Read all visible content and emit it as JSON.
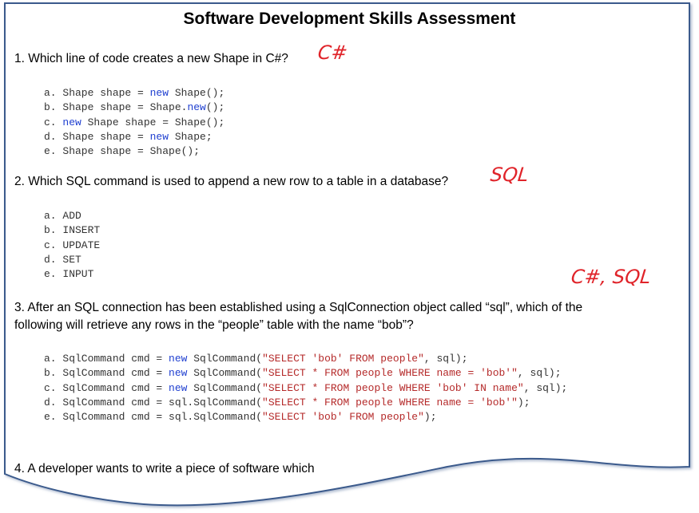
{
  "title": "Software Development Skills Assessment",
  "q1": {
    "text": "1. Which line of code creates a new Shape in C#?",
    "note": "C#",
    "options": [
      [
        {
          "t": "a. Shape shape = ",
          "c": ""
        },
        {
          "t": "new",
          "c": "kw"
        },
        {
          "t": " Shape();",
          "c": ""
        }
      ],
      [
        {
          "t": "b. Shape shape = Shape.",
          "c": ""
        },
        {
          "t": "new",
          "c": "kw"
        },
        {
          "t": "();",
          "c": ""
        }
      ],
      [
        {
          "t": "c. ",
          "c": ""
        },
        {
          "t": "new",
          "c": "kw"
        },
        {
          "t": " Shape shape = Shape();",
          "c": ""
        }
      ],
      [
        {
          "t": "d. Shape shape = ",
          "c": ""
        },
        {
          "t": "new",
          "c": "kw"
        },
        {
          "t": " Shape;",
          "c": ""
        }
      ],
      [
        {
          "t": "e. Shape shape = Shape();",
          "c": ""
        }
      ]
    ]
  },
  "q2": {
    "text": "2. Which SQL command is used to append a new row to a table in a database?",
    "note": "SQL",
    "options": [
      [
        {
          "t": "a. ADD",
          "c": ""
        }
      ],
      [
        {
          "t": "b. INSERT",
          "c": ""
        }
      ],
      [
        {
          "t": "c. UPDATE",
          "c": ""
        }
      ],
      [
        {
          "t": "d. SET",
          "c": ""
        }
      ],
      [
        {
          "t": "e. INPUT",
          "c": ""
        }
      ]
    ]
  },
  "q3": {
    "text_line1": "3. After an SQL connection has been established using a SqlConnection object called “sql”, which of the",
    "text_line2": "following will retrieve any rows in the “people” table with the name “bob”?",
    "note": "C#, SQL",
    "options": [
      [
        {
          "t": "a. SqlCommand cmd = ",
          "c": ""
        },
        {
          "t": "new",
          "c": "kw"
        },
        {
          "t": " SqlCommand(",
          "c": ""
        },
        {
          "t": "\"SELECT 'bob' FROM people\"",
          "c": "str"
        },
        {
          "t": ", sql);",
          "c": ""
        }
      ],
      [
        {
          "t": "b. SqlCommand cmd = ",
          "c": ""
        },
        {
          "t": "new",
          "c": "kw"
        },
        {
          "t": " SqlCommand(",
          "c": ""
        },
        {
          "t": "\"SELECT * FROM people WHERE name = 'bob'\"",
          "c": "str"
        },
        {
          "t": ", sql);",
          "c": ""
        }
      ],
      [
        {
          "t": "c. SqlCommand cmd = ",
          "c": ""
        },
        {
          "t": "new",
          "c": "kw"
        },
        {
          "t": " SqlCommand(",
          "c": ""
        },
        {
          "t": "\"SELECT * FROM people WHERE 'bob' IN name\"",
          "c": "str"
        },
        {
          "t": ", sql);",
          "c": ""
        }
      ],
      [
        {
          "t": "d. SqlCommand cmd = sql.SqlCommand(",
          "c": ""
        },
        {
          "t": "\"SELECT * FROM people WHERE name = 'bob'\"",
          "c": "str"
        },
        {
          "t": ");",
          "c": ""
        }
      ],
      [
        {
          "t": "e. SqlCommand cmd = sql.SqlCommand(",
          "c": ""
        },
        {
          "t": "\"SELECT 'bob' FROM people\"",
          "c": "str"
        },
        {
          "t": ");",
          "c": ""
        }
      ]
    ]
  },
  "q4": {
    "text": "4. A developer wants to write a piece of software which"
  },
  "colors": {
    "border": "#3a5a8c",
    "annotation": "#e0242a",
    "keyword": "#1f3fd0",
    "string": "#b52a2a"
  }
}
